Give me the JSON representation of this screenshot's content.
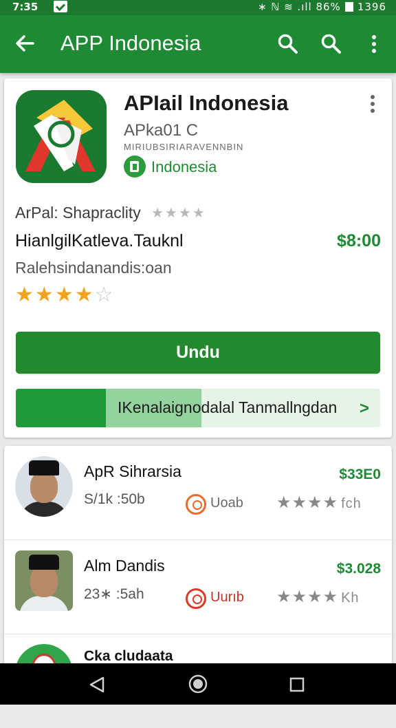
{
  "status_bar": {
    "time": "7:35",
    "right_text": "∗ ℕ ≋ .ıll 86%",
    "clock": "1396"
  },
  "app_bar": {
    "title": "APP Indonesia"
  },
  "app": {
    "name": "APIail Indonesia",
    "developer": "APkа01 C",
    "subtitle": "MIRIUBSIRIARAVENNBIN",
    "badge": "Indonesia",
    "rating_label": "ArPal: Shapraclity",
    "rating_small_stars": "★★★★",
    "name2": "HianlgilKatleva.Tauknl",
    "price": "$8:00",
    "info": "Ralehsindanandis:oan",
    "stars": {
      "filled": 4,
      "total": 5
    },
    "install_label": "Undu",
    "progress": {
      "label": "IKenalaignodalal Tanmallngdan",
      "fraction": 0.51
    }
  },
  "list": [
    {
      "name": "ApR Sihrarsia",
      "meta": "S/1k :50b",
      "price": "$33E0",
      "action": "Uoab",
      "stars": "★★★★",
      "suffix": "fch"
    },
    {
      "name": "Alm Dandis",
      "meta": "23∗ :5ah",
      "price": "$3.028",
      "action": "Uurıb",
      "stars": "★★★★",
      "suffix": "Kh"
    },
    {
      "name": "Cka cludaata",
      "meta": "",
      "price": "",
      "action": "",
      "stars": "",
      "suffix": ""
    }
  ],
  "colors": {
    "brand_green": "#1f8a34",
    "star_gold": "#f2a21b",
    "action_orange": "#e46a2d"
  },
  "icons": [
    "back-arrow-icon",
    "search-icon",
    "more-vert-icon",
    "app-logo-icon",
    "store-badge-icon",
    "star-icon",
    "chevron-right-icon",
    "nav-back-icon",
    "nav-home-icon",
    "nav-recents-icon"
  ]
}
